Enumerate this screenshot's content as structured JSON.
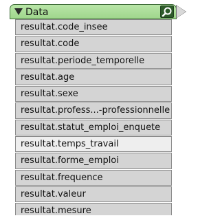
{
  "header": {
    "title": "Data"
  },
  "attributes": [
    {
      "label": "resultat.code_insee"
    },
    {
      "label": "resultat.code"
    },
    {
      "label": "resultat.periode_temporelle"
    },
    {
      "label": "resultat.age"
    },
    {
      "label": "resultat.sexe"
    },
    {
      "label": "resultat.profess...-professionnelle"
    },
    {
      "label": "resultat.statut_emploi_enquete"
    },
    {
      "label": "resultat.temps_travail",
      "highlighted": true
    },
    {
      "label": "resultat.forme_emploi"
    },
    {
      "label": "resultat.frequence"
    },
    {
      "label": "resultat.valeur"
    },
    {
      "label": "resultat.mesure"
    }
  ],
  "icons": {
    "collapse": "triangle-down-icon",
    "search": "magnifier-icon",
    "output_port": "output-port-icon"
  }
}
